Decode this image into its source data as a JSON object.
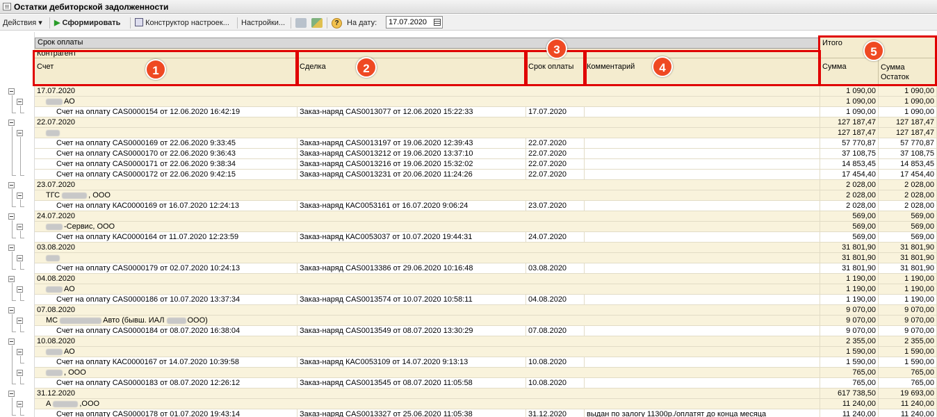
{
  "window": {
    "title": "Остатки дебиторской задолженности"
  },
  "toolbar": {
    "actions": "Действия",
    "form": "Сформировать",
    "constructor": "Конструктор настроек...",
    "settings": "Настройки...",
    "date_label": "На дату:",
    "date_value": "17.07.2020"
  },
  "header": {
    "top": "Срок оплаты",
    "total": "Итого",
    "contractor": "Контрагент",
    "account": "Счет",
    "deal": "Сделка",
    "due": "Срок оплаты",
    "comment": "Комментарий",
    "sum": "Сумма",
    "sum_rest": "Сумма Остаток"
  },
  "annotations": [
    "1",
    "2",
    "3",
    "4",
    "5"
  ],
  "rows": [
    {
      "level": 1,
      "a": "17.07.2020",
      "sum": "1 090,00",
      "rest": "1 090,00"
    },
    {
      "level": 2,
      "a": "АО",
      "blur": true,
      "sum": "1 090,00",
      "rest": "1 090,00"
    },
    {
      "level": 3,
      "a": "Счет на оплату CAS0000154 от 12.06.2020 16:42:19",
      "b": "Заказ-наряд CAS0013077 от 12.06.2020 15:22:33",
      "c": "17.07.2020",
      "sum": "1 090,00",
      "rest": "1 090,00"
    },
    {
      "level": 1,
      "a": "22.07.2020",
      "sum": "127 187,47",
      "rest": "127 187,47"
    },
    {
      "level": 2,
      "a": "",
      "blur": true,
      "sum": "127 187,47",
      "rest": "127 187,47"
    },
    {
      "level": 3,
      "a": "Счет на оплату CAS0000169 от 22.06.2020 9:33:45",
      "b": "Заказ-наряд CAS0013197 от 19.06.2020 12:39:43",
      "c": "22.07.2020",
      "sum": "57 770,87",
      "rest": "57 770,87"
    },
    {
      "level": 3,
      "a": "Счет на оплату CAS0000170 от 22.06.2020 9:36:43",
      "b": "Заказ-наряд CAS0013212 от 19.06.2020 13:37:10",
      "c": "22.07.2020",
      "sum": "37 108,75",
      "rest": "37 108,75"
    },
    {
      "level": 3,
      "a": "Счет на оплату CAS0000171 от 22.06.2020 9:38:34",
      "b": "Заказ-наряд CAS0013216 от 19.06.2020 15:32:02",
      "c": "22.07.2020",
      "sum": "14 853,45",
      "rest": "14 853,45"
    },
    {
      "level": 3,
      "a": "Счет на оплату CAS0000172 от 22.06.2020 9:42:15",
      "b": "Заказ-наряд CAS0013231 от 20.06.2020 11:24:26",
      "c": "22.07.2020",
      "sum": "17 454,40",
      "rest": "17 454,40"
    },
    {
      "level": 1,
      "a": "23.07.2020",
      "sum": "2 028,00",
      "rest": "2 028,00"
    },
    {
      "level": 2,
      "a": "ТГС",
      "a2": ", ООО",
      "blur": true,
      "sum": "2 028,00",
      "rest": "2 028,00"
    },
    {
      "level": 3,
      "a": "Счет на оплату КАС0000169 от 16.07.2020 12:24:13",
      "b": "Заказ-наряд КАС0053161 от 16.07.2020 9:06:24",
      "c": "23.07.2020",
      "sum": "2 028,00",
      "rest": "2 028,00"
    },
    {
      "level": 1,
      "a": "24.07.2020",
      "sum": "569,00",
      "rest": "569,00"
    },
    {
      "level": 2,
      "a": "-Сервис, ООО",
      "blur": true,
      "sum": "569,00",
      "rest": "569,00"
    },
    {
      "level": 3,
      "a": "Счет на оплату КАС0000164 от 11.07.2020 12:23:59",
      "b": "Заказ-наряд КАС0053037 от 10.07.2020 19:44:31",
      "c": "24.07.2020",
      "sum": "569,00",
      "rest": "569,00"
    },
    {
      "level": 1,
      "a": "03.08.2020",
      "sum": "31 801,90",
      "rest": "31 801,90"
    },
    {
      "level": 2,
      "a": "",
      "blur": true,
      "sum": "31 801,90",
      "rest": "31 801,90"
    },
    {
      "level": 3,
      "a": "Счет на оплату CAS0000179 от 02.07.2020 10:24:13",
      "b": "Заказ-наряд CAS0013386 от 29.06.2020 10:16:48",
      "c": "03.08.2020",
      "sum": "31 801,90",
      "rest": "31 801,90"
    },
    {
      "level": 1,
      "a": "04.08.2020",
      "sum": "1 190,00",
      "rest": "1 190,00"
    },
    {
      "level": 2,
      "a": "АО",
      "blur": true,
      "sum": "1 190,00",
      "rest": "1 190,00"
    },
    {
      "level": 3,
      "a": "Счет на оплату CAS0000186 от 10.07.2020 13:37:34",
      "b": "Заказ-наряд CAS0013574 от 10.07.2020 10:58:11",
      "c": "04.08.2020",
      "sum": "1 190,00",
      "rest": "1 190,00"
    },
    {
      "level": 1,
      "a": "07.08.2020",
      "sum": "9 070,00",
      "rest": "9 070,00"
    },
    {
      "level": 2,
      "a": "МС",
      "a2": "Авто (бывш. ИАЛ",
      "a3": "ООО)",
      "blur": true,
      "sum": "9 070,00",
      "rest": "9 070,00"
    },
    {
      "level": 3,
      "a": "Счет на оплату CAS0000184 от 08.07.2020 16:38:04",
      "b": "Заказ-наряд CAS0013549 от 08.07.2020 13:30:29",
      "c": "07.08.2020",
      "sum": "9 070,00",
      "rest": "9 070,00"
    },
    {
      "level": 1,
      "a": "10.08.2020",
      "sum": "2 355,00",
      "rest": "2 355,00"
    },
    {
      "level": 2,
      "a": "АО",
      "blur": true,
      "sum": "1 590,00",
      "rest": "1 590,00"
    },
    {
      "level": 3,
      "a": "Счет на оплату КАС0000167 от 14.07.2020 10:39:58",
      "b": "Заказ-наряд КАС0053109 от 14.07.2020 9:13:13",
      "c": "10.08.2020",
      "sum": "1 590,00",
      "rest": "1 590,00"
    },
    {
      "level": 2,
      "a": ", ООО",
      "blur": true,
      "sum": "765,00",
      "rest": "765,00"
    },
    {
      "level": 3,
      "a": "Счет на оплату CAS0000183 от 08.07.2020 12:26:12",
      "b": "Заказ-наряд CAS0013545 от 08.07.2020 11:05:58",
      "c": "10.08.2020",
      "sum": "765,00",
      "rest": "765,00"
    },
    {
      "level": 1,
      "a": "31.12.2020",
      "sum": "617 738,50",
      "rest": "19 693,00"
    },
    {
      "level": 2,
      "a": "А",
      "a2": ",ООО",
      "blur": true,
      "sum": "11 240,00",
      "rest": "11 240,00"
    },
    {
      "level": 3,
      "a": "Счет на оплату CAS0000178 от 01.07.2020 19:43:14",
      "b": "Заказ-наряд CAS0013327 от 25.06.2020 11:05:38",
      "c": "31.12.2020",
      "d": "выдан по залогу 11300р./оплатят до конца месяца",
      "sum": "11 240,00",
      "rest": "11 240,00"
    }
  ]
}
